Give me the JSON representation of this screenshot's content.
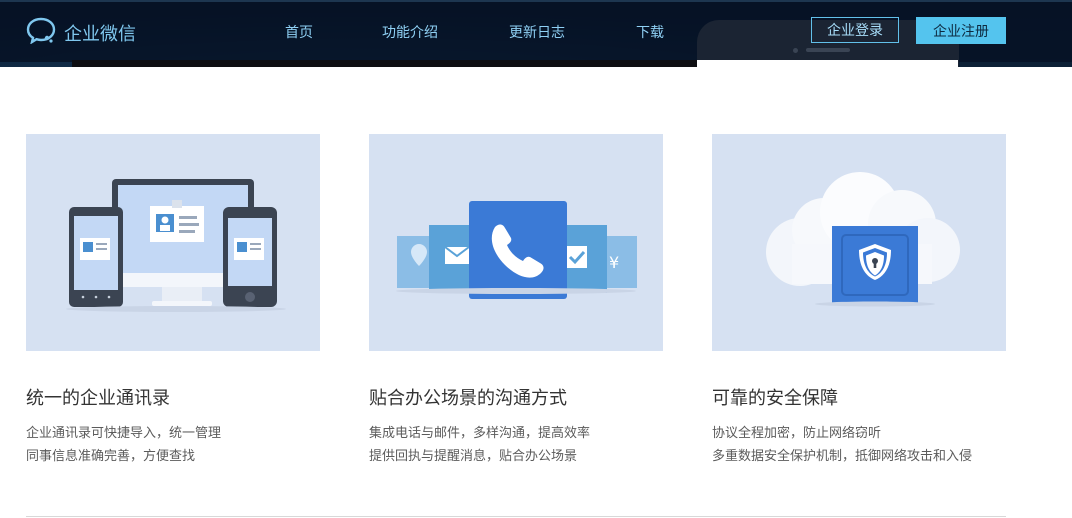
{
  "brand": {
    "name": "企业微信",
    "icon": "chat-bubble-icon",
    "color": "#7fc7ee"
  },
  "nav": {
    "items": [
      {
        "label": "首页"
      },
      {
        "label": "功能介绍"
      },
      {
        "label": "更新日志"
      },
      {
        "label": "下载"
      }
    ]
  },
  "auth": {
    "login_label": "企业登录",
    "register_label": "企业注册",
    "accent": "#54c4ee"
  },
  "features": [
    {
      "title": "统一的企业通讯录",
      "lines": [
        "企业通讯录可快捷导入，统一管理",
        "同事信息准确完善，方便查找"
      ],
      "illustration": "devices-contacts-illustration"
    },
    {
      "title": "贴合办公场景的沟通方式",
      "lines": [
        "集成电话与邮件，多样沟通，提高效率",
        "提供回执与提醒消息，贴合办公场景"
      ],
      "illustration": "communication-cards-illustration"
    },
    {
      "title": "可靠的安全保障",
      "lines": [
        "协议全程加密，防止网络窃听",
        "多重数据安全保护机制，抵御网络攻击和入侵"
      ],
      "illustration": "cloud-security-illustration"
    }
  ],
  "colors": {
    "card_bg": "#d6e1f2",
    "header_bg": "#0a1a2e",
    "title_text": "#333333",
    "desc_text": "#5b5b5b"
  }
}
